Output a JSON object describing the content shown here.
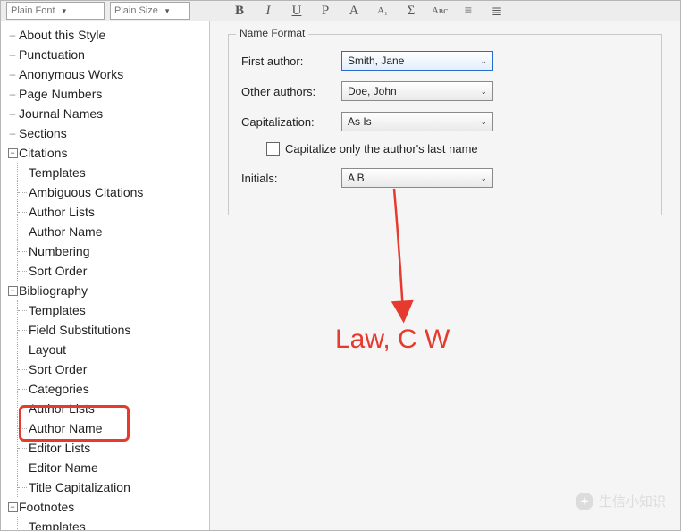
{
  "toolbar": {
    "font_combo": "Plain Font",
    "size_combo": "Plain Size",
    "buttons": [
      "B",
      "I",
      "U",
      "P",
      "A",
      "A₁",
      "Σ",
      "Aʙc",
      "≡",
      "≣"
    ]
  },
  "tree": {
    "root": [
      "About this Style",
      "Punctuation",
      "Anonymous Works",
      "Page Numbers",
      "Journal Names",
      "Sections"
    ],
    "citations": {
      "label": "Citations",
      "children": [
        "Templates",
        "Ambiguous Citations",
        "Author Lists",
        "Author Name",
        "Numbering",
        "Sort Order"
      ]
    },
    "bibliography": {
      "label": "Bibliography",
      "children": [
        "Templates",
        "Field Substitutions",
        "Layout",
        "Sort Order",
        "Categories",
        "Author Lists",
        "Author Name",
        "Editor Lists",
        "Editor Name",
        "Title Capitalization"
      ]
    },
    "footnotes": {
      "label": "Footnotes",
      "children": [
        "Templates"
      ]
    }
  },
  "panel": {
    "group_title": "Name Format",
    "first_author_label": "First author:",
    "first_author_value": "Smith, Jane",
    "other_authors_label": "Other authors:",
    "other_authors_value": "Doe, John",
    "capitalization_label": "Capitalization:",
    "capitalization_value": "As Is",
    "checkbox_label": "Capitalize only the author's last name",
    "initials_label": "Initials:",
    "initials_value": "A B"
  },
  "annotation": {
    "text": "Law, C W"
  },
  "watermark": {
    "text": "生信小知识"
  }
}
